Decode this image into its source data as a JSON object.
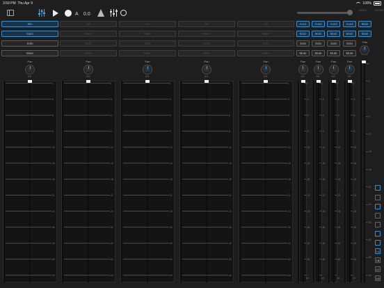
{
  "status": {
    "time": "3:59 PM",
    "date": "Thu Apr 9",
    "battery": "100%"
  },
  "transport": {
    "a_label": "A",
    "position": "0.0"
  },
  "master_controls": {
    "btn1": "SOLO",
    "btn2": "CLEAR"
  },
  "channels": [
    {
      "name": "Mix",
      "main": "Main",
      "solo": "Solo",
      "mute": "Mute",
      "active": true
    },
    {
      "name": "S2",
      "main": "Main",
      "solo": "Solo",
      "mute": "Mute",
      "active": false
    },
    {
      "name": "S3",
      "main": "Main",
      "solo": "Solo",
      "mute": "Mute",
      "active": false
    },
    {
      "name": "S4",
      "main": "Main",
      "solo": "Solo",
      "mute": "Mute",
      "active": false
    },
    {
      "name": "Clk",
      "main": "Main",
      "solo": "Solo",
      "mute": "Mute",
      "active": false
    }
  ],
  "aux": [
    {
      "name": "Aux1",
      "main": "Main",
      "solo": "Solo",
      "mute": "Mute"
    },
    {
      "name": "Aux2",
      "main": "Main",
      "solo": "Solo",
      "mute": "Mute"
    },
    {
      "name": "Aux3",
      "main": "Main",
      "solo": "Solo",
      "mute": "Mute"
    },
    {
      "name": "Aux4",
      "main": "Main",
      "solo": "Solo",
      "mute": "Mute"
    }
  ],
  "master": {
    "name": "Main",
    "main": "Main",
    "pan": "Pan"
  },
  "pan_label": "Pan",
  "pan_value": "0.0",
  "scale_labels": [
    "0",
    "-3",
    "-6",
    "-9",
    "-12",
    "-15",
    "-18",
    "-21",
    "-24",
    "-30",
    "-40",
    "-60",
    "-inf"
  ],
  "side_buttons": [
    "1A",
    "1B",
    "1C",
    "1D"
  ]
}
